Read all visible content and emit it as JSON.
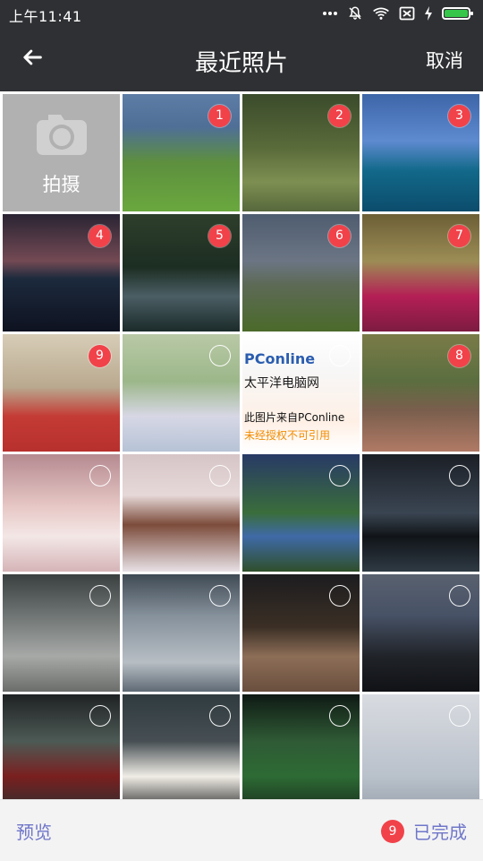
{
  "status_bar": {
    "time": "上午11:41",
    "icons": [
      "more-icon",
      "muted-bell-icon",
      "wifi-icon",
      "sim-icon",
      "charging-icon",
      "battery-icon"
    ]
  },
  "header": {
    "title": "最近照片",
    "back_icon": "back-arrow-icon",
    "cancel_label": "取消",
    "background_color": "#2f3033"
  },
  "grid": {
    "camera_label": "拍摄",
    "camera_icon": "camera-icon",
    "photos": [
      {
        "selected": true,
        "order": "1"
      },
      {
        "selected": true,
        "order": "2"
      },
      {
        "selected": true,
        "order": "3"
      },
      {
        "selected": true,
        "order": "4"
      },
      {
        "selected": true,
        "order": "5"
      },
      {
        "selected": true,
        "order": "6"
      },
      {
        "selected": true,
        "order": "7"
      },
      {
        "selected": true,
        "order": "9"
      },
      {
        "selected": false,
        "order": ""
      },
      {
        "selected": false,
        "order": "",
        "overlay_lines": [
          "PConline",
          "太平洋电脑网",
          "此图片来自PConline",
          "未经授权不可引用"
        ]
      },
      {
        "selected": true,
        "order": "8"
      },
      {
        "selected": false,
        "order": ""
      },
      {
        "selected": false,
        "order": ""
      },
      {
        "selected": false,
        "order": ""
      },
      {
        "selected": false,
        "order": ""
      },
      {
        "selected": false,
        "order": ""
      },
      {
        "selected": false,
        "order": ""
      },
      {
        "selected": false,
        "order": ""
      },
      {
        "selected": false,
        "order": ""
      },
      {
        "selected": false,
        "order": ""
      },
      {
        "selected": false,
        "order": ""
      },
      {
        "selected": false,
        "order": ""
      },
      {
        "selected": false,
        "order": ""
      }
    ]
  },
  "footer": {
    "preview_label": "预览",
    "selected_count": "9",
    "done_label": "已完成",
    "accent_color": "#6f76c9",
    "badge_color": "#f1424a"
  }
}
